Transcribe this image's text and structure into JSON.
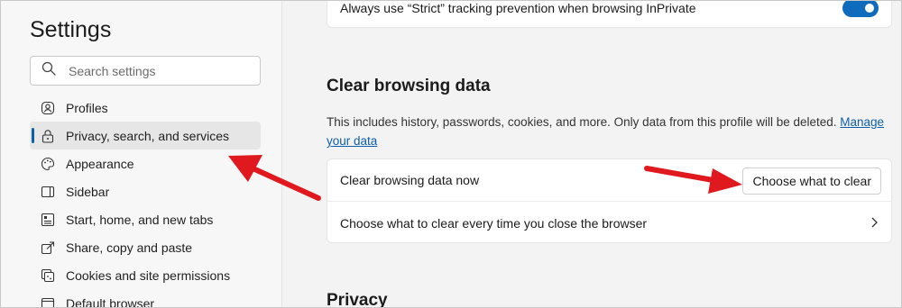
{
  "sidebar": {
    "title": "Settings",
    "search_placeholder": "Search settings",
    "items": [
      {
        "label": "Profiles",
        "icon": "profile-icon"
      },
      {
        "label": "Privacy, search, and services",
        "icon": "lock-icon",
        "active": true
      },
      {
        "label": "Appearance",
        "icon": "palette-icon"
      },
      {
        "label": "Sidebar",
        "icon": "sidebar-icon"
      },
      {
        "label": "Start, home, and new tabs",
        "icon": "home-tabs-icon"
      },
      {
        "label": "Share, copy and paste",
        "icon": "share-icon"
      },
      {
        "label": "Cookies and site permissions",
        "icon": "cookies-icon"
      },
      {
        "label": "Default browser",
        "icon": "browser-icon"
      }
    ]
  },
  "main": {
    "strict_row": {
      "label": "Always use “Strict” tracking prevention when browsing InPrivate",
      "toggle_on": true
    },
    "clear_section": {
      "title": "Clear browsing data",
      "description": "This includes history, passwords, cookies, and more. Only data from this profile will be deleted.",
      "link": "Manage your data",
      "rows": [
        {
          "label": "Clear browsing data now",
          "button": "Choose what to clear"
        },
        {
          "label": "Choose what to clear every time you close the browser"
        }
      ]
    },
    "next_section_title": "Privacy"
  },
  "colors": {
    "accent": "#0f6cbd",
    "annotation_arrow": "#e0191e"
  }
}
